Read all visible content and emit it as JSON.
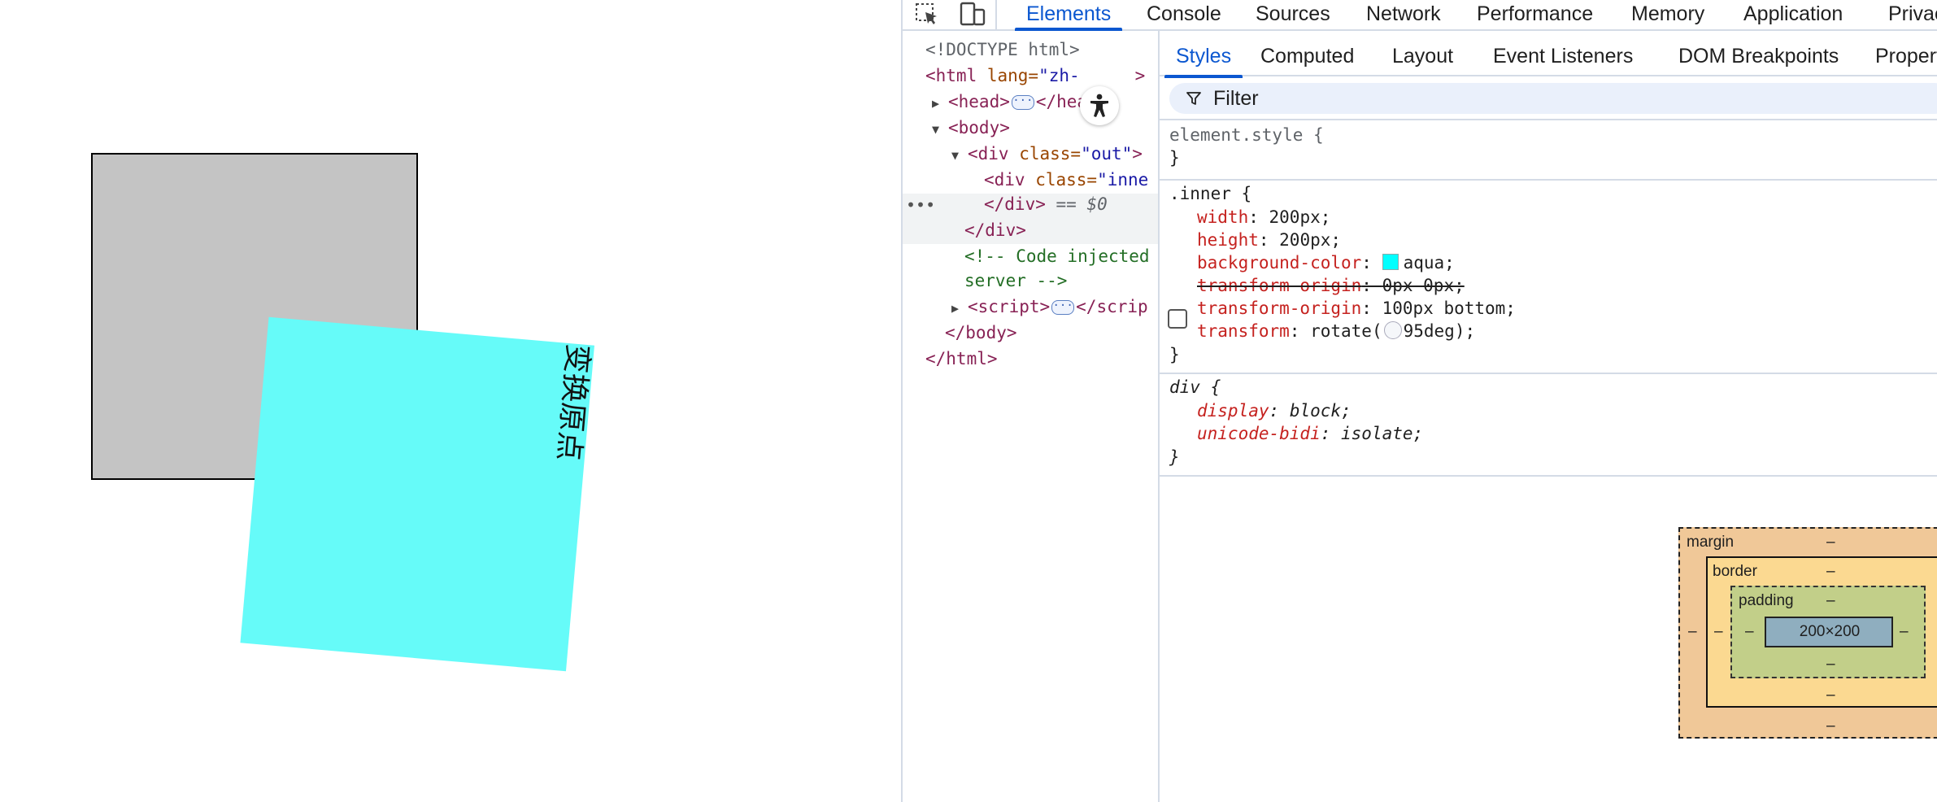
{
  "viewport": {
    "inner_text": "变换原点",
    "colors": {
      "outer_bg": "#c4c4c4",
      "inner_bg": "#66fbf9"
    }
  },
  "devtools": {
    "main_tabs": [
      {
        "label": "Elements",
        "active": true
      },
      {
        "label": "Console"
      },
      {
        "label": "Sources"
      },
      {
        "label": "Network"
      },
      {
        "label": "Performance"
      },
      {
        "label": "Memory"
      },
      {
        "label": "Application"
      },
      {
        "label": "Privac"
      }
    ],
    "dom": {
      "doctype": "<!DOCTYPE html>",
      "html_open": "<html ",
      "html_attr": "lang=",
      "html_val": "\"zh-",
      "html_close_frag": ">",
      "head_open": "<head>",
      "head_close": "</head>",
      "body_open": "<body>",
      "div_out_open": "<div ",
      "div_out_attr": "class=",
      "div_out_val": "\"out\"",
      "div_out_end": ">",
      "div_inner_open": "<div ",
      "div_inner_attr": "class=",
      "div_inner_val": "\"inne",
      "div_inner_close": "</div>",
      "selected_marker": "== $0",
      "div_out_close": "</div>",
      "comment_1": "<!-- Code injected",
      "comment_2": "server -->",
      "script_open": "<script>",
      "script_close": "</scrip",
      "body_close": "</body>",
      "html_close": "</html>",
      "row_menu": "•••"
    },
    "sub_tabs": [
      {
        "label": "Styles",
        "active": true
      },
      {
        "label": "Computed"
      },
      {
        "label": "Layout"
      },
      {
        "label": "Event Listeners"
      },
      {
        "label": "DOM Breakpoints"
      },
      {
        "label": "Propert"
      }
    ],
    "filter_placeholder": "Filter",
    "styles": {
      "element_style_selector": "element.style {",
      "close_brace": "}",
      "inner_selector": ".inner {",
      "inner_props": [
        {
          "name": "width",
          "value": "200px;"
        },
        {
          "name": "height",
          "value": "200px;"
        },
        {
          "name": "background-color",
          "value": "aqua;"
        },
        {
          "name": "transform-origin",
          "value": "0px 0px;",
          "disabled": true
        },
        {
          "name": "transform-origin",
          "value": "100px bottom;"
        },
        {
          "name": "transform",
          "value_prefix": "rotate(",
          "value_suffix": "95deg);"
        }
      ],
      "div_selector": "div {",
      "div_props": [
        {
          "name": "display",
          "value": "block;"
        },
        {
          "name": "unicode-bidi",
          "value": "isolate;"
        }
      ]
    },
    "box_model": {
      "margin_label": "margin",
      "border_label": "border",
      "padding_label": "padding",
      "content_size": "200×200",
      "dash": "–"
    }
  }
}
